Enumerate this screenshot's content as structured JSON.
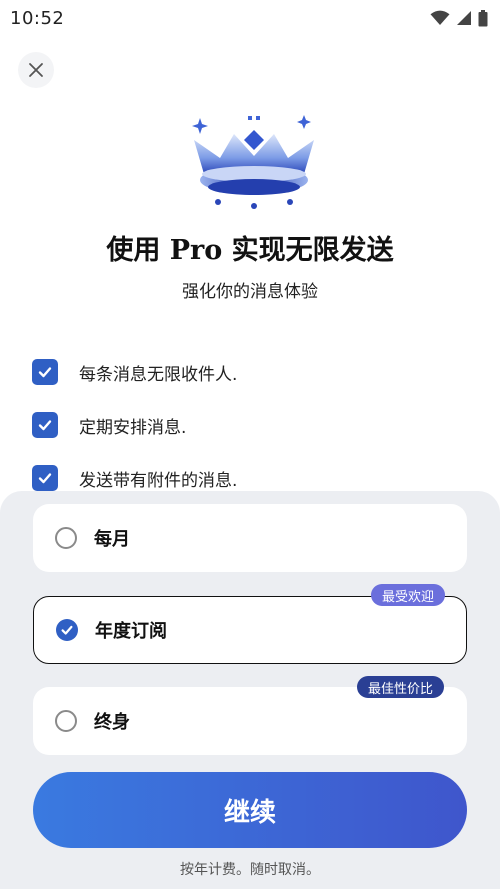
{
  "status_bar": {
    "time": "10:52"
  },
  "header": {
    "title": "使用 Pro 实现无限发送",
    "subtitle": "强化你的消息体验"
  },
  "features": [
    {
      "label": "每条消息无限收件人.",
      "checked": true
    },
    {
      "label": "定期安排消息.",
      "checked": true
    },
    {
      "label": "发送带有附件的消息.",
      "checked": true
    }
  ],
  "plans": [
    {
      "label": "每月",
      "selected": false,
      "badge": ""
    },
    {
      "label": "年度订阅",
      "selected": true,
      "badge": "最受欢迎"
    },
    {
      "label": "终身",
      "selected": false,
      "badge": "最佳性价比"
    }
  ],
  "cta": {
    "label": "继续"
  },
  "footnote": "按年计费。随时取消。",
  "colors": {
    "accent": "#2f5fc4",
    "cta_gradient_start": "#3a7ae0",
    "cta_gradient_end": "#3f56cc",
    "badge_popular": "#6b6fdc",
    "badge_value": "#2a3f94",
    "sheet_background": "#eceef2"
  },
  "icons": {
    "close": "close-icon",
    "crown": "crown-icon",
    "check": "check-icon",
    "wifi": "wifi-icon",
    "signal": "signal-icon",
    "battery": "battery-icon"
  }
}
